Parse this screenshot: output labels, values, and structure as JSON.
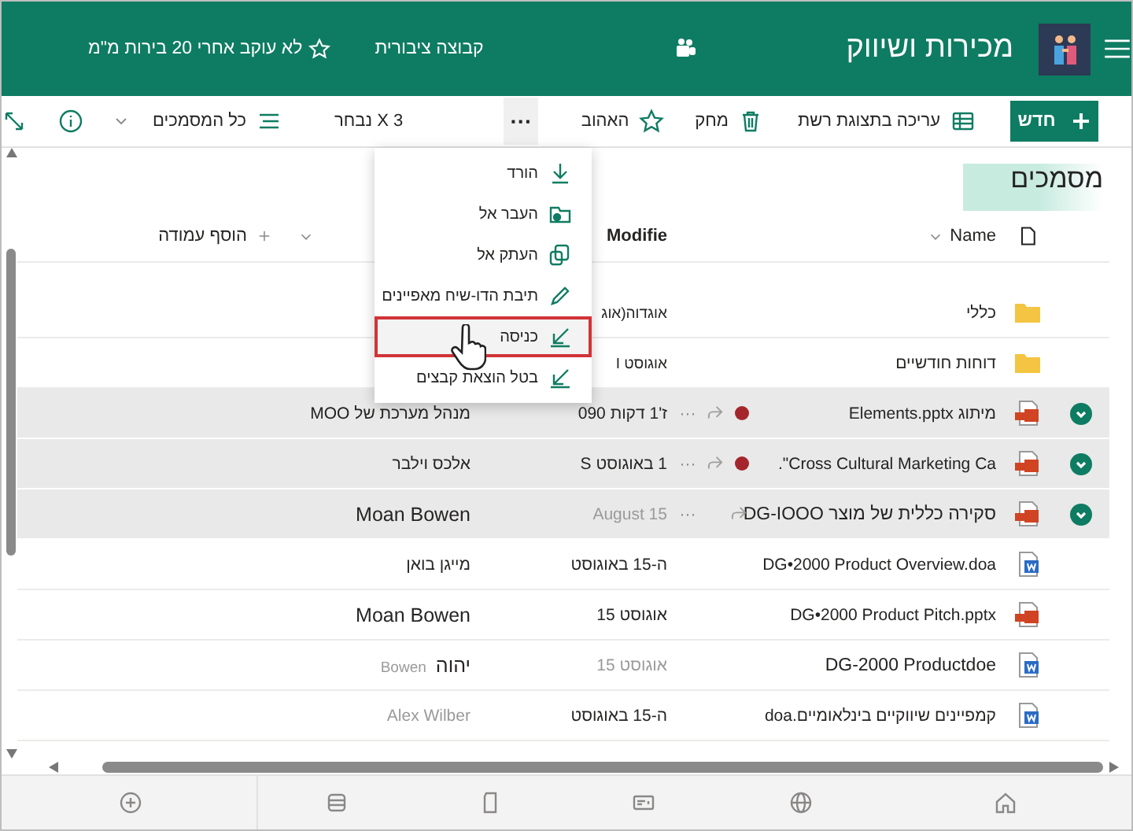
{
  "header": {
    "title": "מכירות ושיווק",
    "group_type": "קבוצה ציבורית",
    "follow": {
      "label": "לא עוקב אחרי 20 בירות מ\"מ",
      "following": false
    }
  },
  "toolbar": {
    "new_button": "חדש",
    "actions": [
      {
        "kind": "grid",
        "label": "עריכה בתצוגת רשת"
      },
      {
        "kind": "trash",
        "label": "מחק"
      },
      {
        "kind": "star",
        "label": "האהוב"
      }
    ],
    "more": "···",
    "selection": "3 X נבחר",
    "view": "כל המסמכים"
  },
  "library": {
    "title": "מסמכים",
    "columns": {
      "name": "Name",
      "modified": "Modifie",
      "add_column": "הוסף עמודה"
    },
    "rows": [
      {
        "kind": "folder",
        "name": "כללי",
        "modified": "אוגדוה(אוג",
        "selected": false
      },
      {
        "kind": "folder",
        "name": "דוחות חודשיים",
        "modified": "אוגוסט I",
        "selected": false
      },
      {
        "kind": "pptx",
        "name": "מיתוג Elements.pptx",
        "modified": "ז'1 דקות 090",
        "modified_by": "מנהל מערכת של MOO",
        "selected": true,
        "checked_out": true,
        "more": "···"
      },
      {
        "kind": "pptx",
        "name": "Cross Cultural Marketing Ca\".",
        "modified": "1 באוגוסט S",
        "modified_by": "אלכס וילבר",
        "selected": true,
        "checked_out": true,
        "more": "···"
      },
      {
        "kind": "pptx",
        "name": "סקירה כללית של מוצר DG-IOOO",
        "modified": "August 15",
        "modified_by": "Moan Bowen",
        "selected": true,
        "checked_out": false,
        "large": true,
        "more": "···"
      },
      {
        "kind": "docx",
        "name": "DG•2000 Product Overview.doa",
        "modified": "ה-15 באוגוסט",
        "modified_by": "מייגן בואן",
        "selected": false
      },
      {
        "kind": "pptx",
        "name": "DG•2000 Product Pitch.pptx",
        "modified": "אוגוסט 15",
        "modified_by": "Moan Bowen",
        "selected": false,
        "large_by": true
      },
      {
        "kind": "docx",
        "name": "DG-2000 Productdoe",
        "modified": "אוגוסט 15",
        "modified_by": "יהוה",
        "modified_by_extra": "Bowen",
        "selected": false,
        "large": true,
        "large_by": true
      },
      {
        "kind": "docx",
        "name": "קמפיינים שיווקיים בינלאומיים.doa",
        "modified": "ה-15 באוגוסט",
        "modified_by": "Alex Wilber",
        "selected": false,
        "muted_by": true
      }
    ]
  },
  "menu": {
    "items": [
      {
        "kind": "download",
        "label": "הורד",
        "hovered": false
      },
      {
        "kind": "move",
        "label": "העבר אל",
        "hovered": false
      },
      {
        "kind": "copy",
        "label": "העתק אל",
        "hovered": false
      },
      {
        "kind": "pencil",
        "label": "תיבת הדו-שיח מאפיינים",
        "hovered": false
      },
      {
        "kind": "checkin",
        "label": "כניסה",
        "hovered": true
      },
      {
        "kind": "checkin",
        "label": "בטל הוצאת קבצים",
        "hovered": false
      }
    ]
  }
}
